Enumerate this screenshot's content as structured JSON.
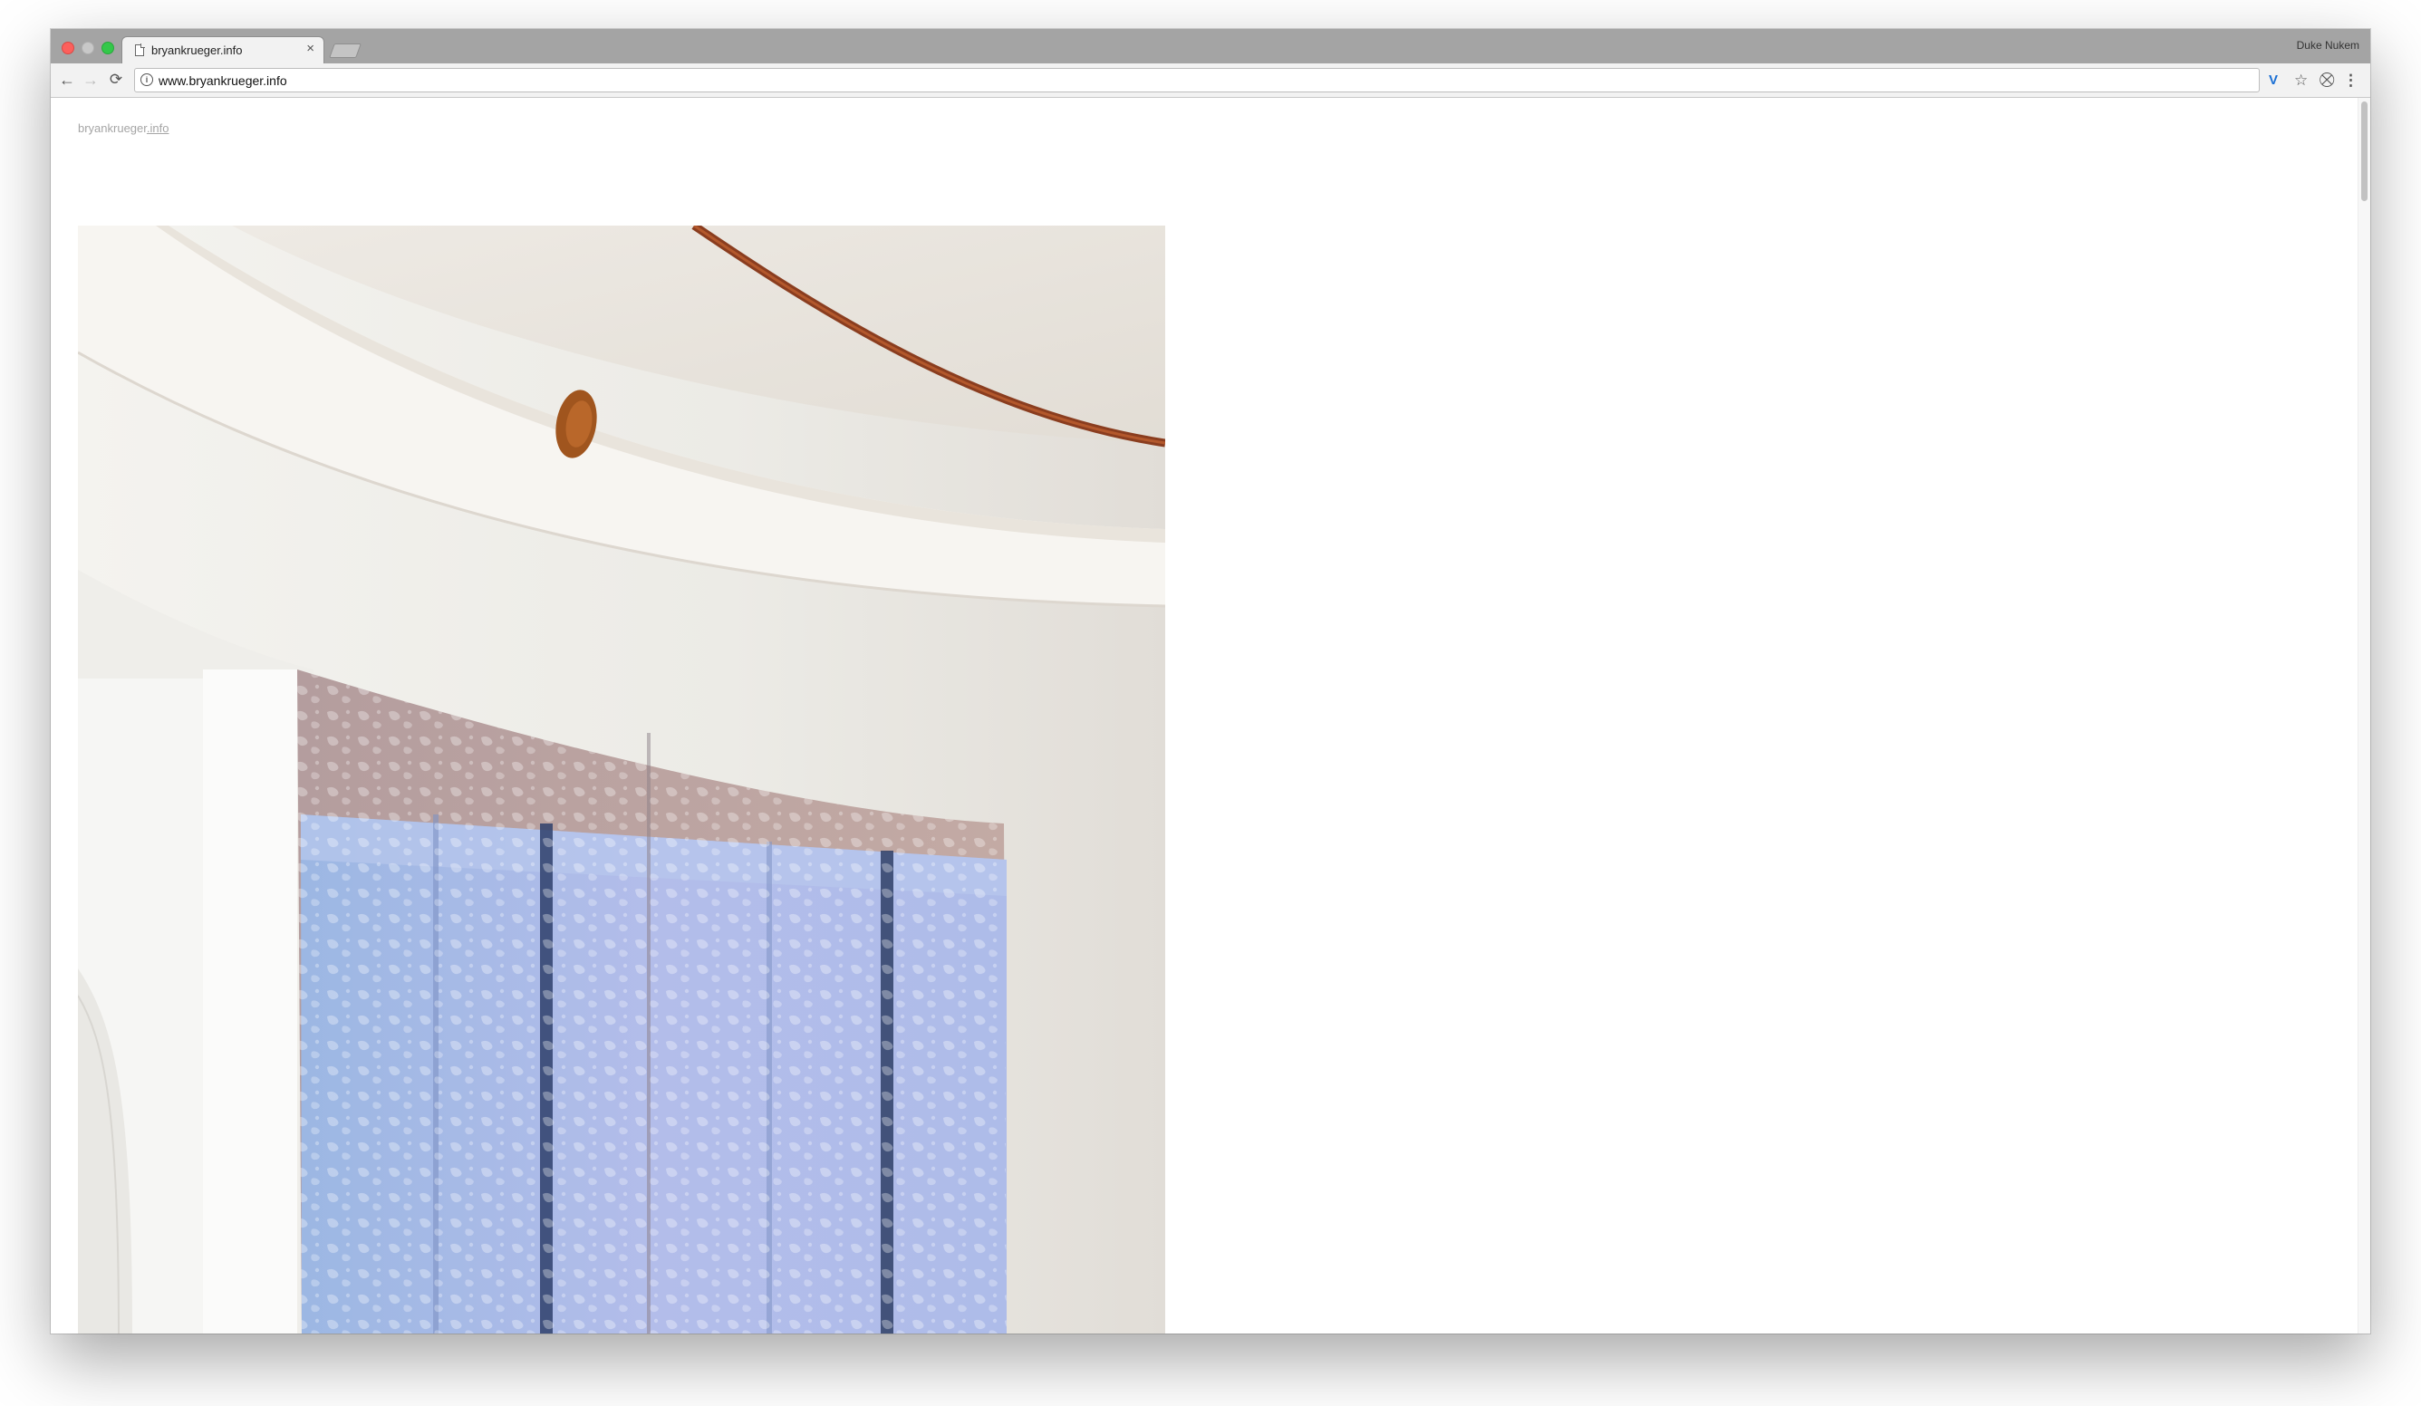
{
  "browser": {
    "tab": {
      "title": "bryankrueger.info",
      "close": "×"
    },
    "profile_name": "Duke Nukem",
    "address": {
      "url": "www.bryankrueger.info"
    },
    "nav": {
      "back": "←",
      "forward": "→",
      "reload": "⟳"
    },
    "icons": {
      "info": "i",
      "extension": "V",
      "star": "☆",
      "extension2": "⛒",
      "menu": "⋮"
    }
  },
  "page": {
    "site_name": "bryankrueger",
    "site_tld": ".info",
    "photo_description_name": "artwork-photo"
  },
  "colors": {
    "titlebar": "#a4a4a4",
    "toolbar": "#f2f2f2",
    "site_title": "#a5a5a5"
  }
}
